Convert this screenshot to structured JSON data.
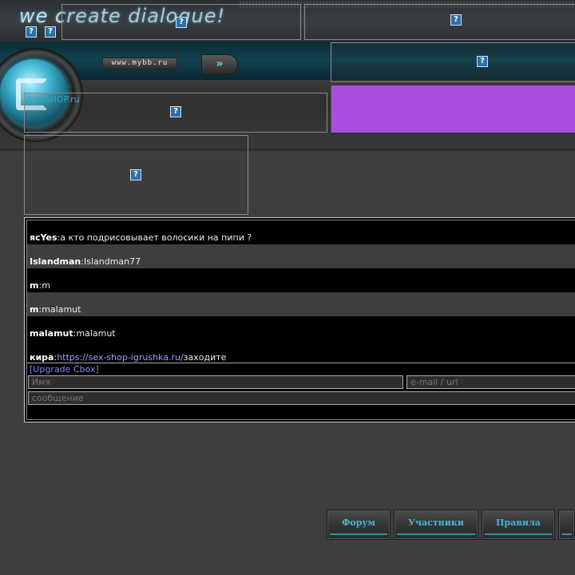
{
  "header": {
    "logo_text": "we create dialogue!",
    "url_pill": "www.mybb.ru",
    "arrow_glyph": "»",
    "shop_link": "fun-SHOP.ru"
  },
  "placeholders": {
    "icon_glyph": "?"
  },
  "chat": {
    "messages": [
      {
        "nick": "ясYes",
        "sep": ": ",
        "text": "а кто подрисовывает волосики на пипи ?",
        "link": ""
      },
      {
        "nick": "Islandman",
        "sep": ": ",
        "text": "Islandman77",
        "link": ""
      },
      {
        "nick": "m",
        "sep": ": ",
        "text": "m",
        "link": ""
      },
      {
        "nick": "m",
        "sep": ": ",
        "text": "malamut",
        "link": ""
      },
      {
        "nick": "malamut",
        "sep": ": ",
        "text": "malamut",
        "link": ""
      },
      {
        "nick": "кира",
        "sep": ": ",
        "text": " заходите",
        "link": "https://sex-shop-igrushka.ru/"
      }
    ],
    "upgrade_label": "[Upgrade Cbox]",
    "name_placeholder": "Имя",
    "email_placeholder": "e-mail / url",
    "message_placeholder": "сообщение"
  },
  "nav": {
    "forum": "Форум",
    "members": "Участники",
    "rules": "Правила",
    "more": ""
  },
  "colors": {
    "accent": "#4ab3d4",
    "purple_block": "#a94de0",
    "link": "#8fa9ff"
  }
}
